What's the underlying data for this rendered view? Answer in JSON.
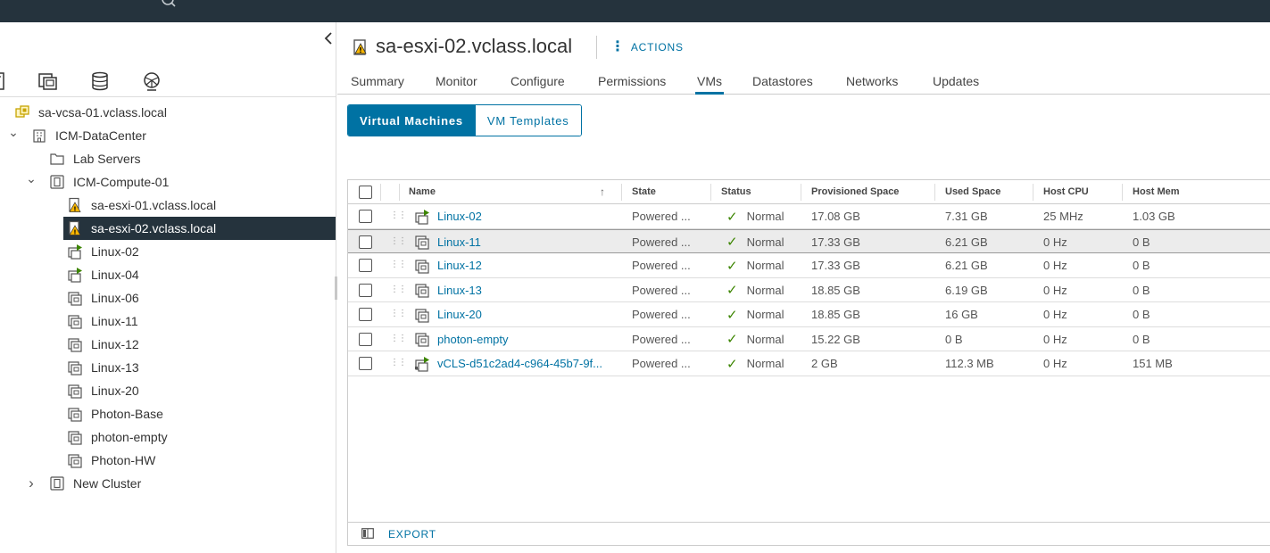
{
  "colors": {
    "accent": "#0072a3",
    "header_bg": "#25333d",
    "ok_green": "#3c8500",
    "warning": "#f7b500"
  },
  "left_nav": {
    "icons": [
      {
        "name": "hosts-clusters-icon",
        "active": true
      },
      {
        "name": "vms-templates-icon",
        "active": false
      },
      {
        "name": "storage-icon",
        "active": false
      },
      {
        "name": "networking-icon",
        "active": false
      }
    ]
  },
  "tree": {
    "items": [
      {
        "label": "sa-vcsa-01.vclass.local",
        "icon": "vcenter-icon",
        "depth": 0,
        "caret": "",
        "selected": false
      },
      {
        "label": "ICM-DataCenter",
        "icon": "datacenter-icon",
        "depth": 1,
        "caret": "expanded",
        "selected": false
      },
      {
        "label": "Lab Servers",
        "icon": "folder-icon",
        "depth": 2,
        "caret": "",
        "selected": false
      },
      {
        "label": "ICM-Compute-01",
        "icon": "cluster-icon",
        "depth": 2,
        "caret": "expanded",
        "selected": false
      },
      {
        "label": "sa-esxi-01.vclass.local",
        "icon": "host-warning-icon",
        "depth": 3,
        "caret": "",
        "selected": false
      },
      {
        "label": "sa-esxi-02.vclass.local",
        "icon": "host-warning-icon",
        "depth": 3,
        "caret": "",
        "selected": true
      },
      {
        "label": "Linux-02",
        "icon": "vm-powered-on-icon",
        "depth": 3,
        "caret": "",
        "selected": false
      },
      {
        "label": "Linux-04",
        "icon": "vm-powered-on-icon",
        "depth": 3,
        "caret": "",
        "selected": false
      },
      {
        "label": "Linux-06",
        "icon": "vm-icon",
        "depth": 3,
        "caret": "",
        "selected": false
      },
      {
        "label": "Linux-11",
        "icon": "vm-icon",
        "depth": 3,
        "caret": "",
        "selected": false
      },
      {
        "label": "Linux-12",
        "icon": "vm-icon",
        "depth": 3,
        "caret": "",
        "selected": false
      },
      {
        "label": "Linux-13",
        "icon": "vm-icon",
        "depth": 3,
        "caret": "",
        "selected": false
      },
      {
        "label": "Linux-20",
        "icon": "vm-icon",
        "depth": 3,
        "caret": "",
        "selected": false
      },
      {
        "label": "Photon-Base",
        "icon": "vm-icon",
        "depth": 3,
        "caret": "",
        "selected": false
      },
      {
        "label": "photon-empty",
        "icon": "vm-icon",
        "depth": 3,
        "caret": "",
        "selected": false
      },
      {
        "label": "Photon-HW",
        "icon": "vm-icon",
        "depth": 3,
        "caret": "",
        "selected": false
      },
      {
        "label": "New Cluster",
        "icon": "cluster-icon",
        "depth": 2,
        "caret": "collapsed",
        "selected": false
      }
    ]
  },
  "header": {
    "title": "sa-esxi-02.vclass.local",
    "title_icon": "host-warning-icon",
    "actions_label": "ACTIONS"
  },
  "tabs": [
    {
      "label": "Summary",
      "active": false
    },
    {
      "label": "Monitor",
      "active": false
    },
    {
      "label": "Configure",
      "active": false
    },
    {
      "label": "Permissions",
      "active": false
    },
    {
      "label": "VMs",
      "active": true
    },
    {
      "label": "Datastores",
      "active": false
    },
    {
      "label": "Networks",
      "active": false
    },
    {
      "label": "Updates",
      "active": false
    }
  ],
  "segments": [
    {
      "label": "Virtual Machines",
      "active": true
    },
    {
      "label": "VM Templates",
      "active": false
    }
  ],
  "grid": {
    "columns": [
      "Name",
      "State",
      "Status",
      "Provisioned Space",
      "Used Space",
      "Host CPU",
      "Host Mem"
    ],
    "sort_icon": "arrow-up-icon",
    "rows": [
      {
        "name": "Linux-02",
        "icon": "vm-powered-on-icon",
        "state": "Powered ...",
        "status": "Normal",
        "provisioned": "17.08 GB",
        "used": "7.31 GB",
        "cpu": "25 MHz",
        "mem": "1.03 GB",
        "highlighted": false
      },
      {
        "name": "Linux-11",
        "icon": "vm-icon",
        "state": "Powered ...",
        "status": "Normal",
        "provisioned": "17.33 GB",
        "used": "6.21 GB",
        "cpu": "0 Hz",
        "mem": "0 B",
        "highlighted": true
      },
      {
        "name": "Linux-12",
        "icon": "vm-icon",
        "state": "Powered ...",
        "status": "Normal",
        "provisioned": "17.33 GB",
        "used": "6.21 GB",
        "cpu": "0 Hz",
        "mem": "0 B",
        "highlighted": false
      },
      {
        "name": "Linux-13",
        "icon": "vm-icon",
        "state": "Powered ...",
        "status": "Normal",
        "provisioned": "18.85 GB",
        "used": "6.19 GB",
        "cpu": "0 Hz",
        "mem": "0 B",
        "highlighted": false
      },
      {
        "name": "Linux-20",
        "icon": "vm-icon",
        "state": "Powered ...",
        "status": "Normal",
        "provisioned": "18.85 GB",
        "used": "16 GB",
        "cpu": "0 Hz",
        "mem": "0 B",
        "highlighted": false
      },
      {
        "name": "photon-empty",
        "icon": "vm-icon",
        "state": "Powered ...",
        "status": "Normal",
        "provisioned": "15.22 GB",
        "used": "0 B",
        "cpu": "0 Hz",
        "mem": "0 B",
        "highlighted": false
      },
      {
        "name": "vCLS-d51c2ad4-c964-45b7-9f...",
        "icon": "vcls-vm-icon",
        "state": "Powered ...",
        "status": "Normal",
        "provisioned": "2 GB",
        "used": "112.3 MB",
        "cpu": "0 Hz",
        "mem": "151 MB",
        "highlighted": false
      }
    ],
    "footer": {
      "export_label": "EXPORT",
      "columns_icon": "column-toggle-icon"
    }
  }
}
